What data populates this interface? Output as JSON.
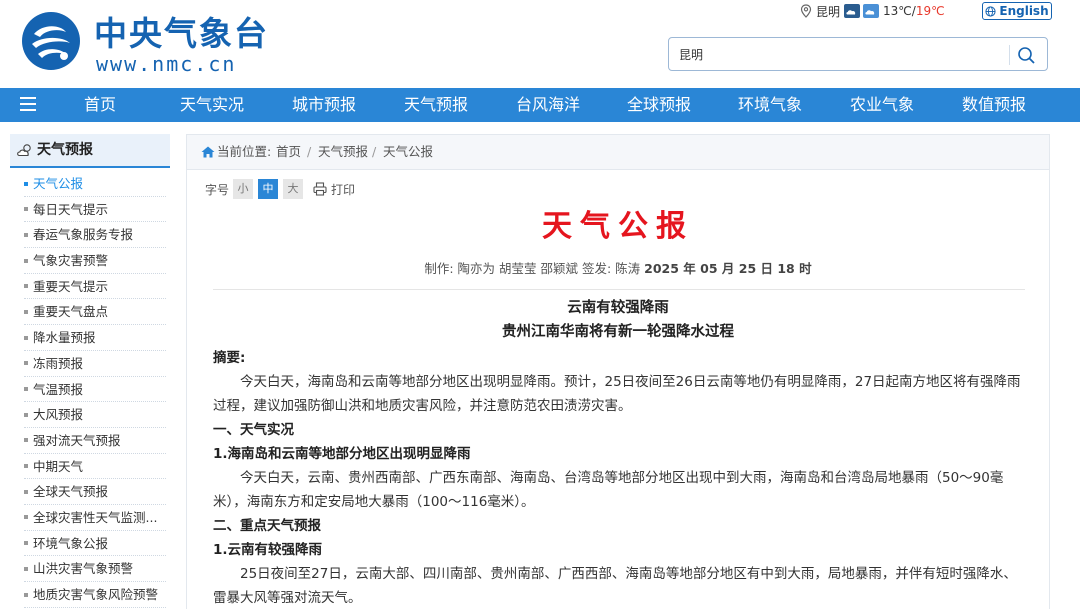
{
  "header": {
    "site_name_cn": "中央气象台",
    "site_name_en": "www.nmc.cn",
    "city": "昆明",
    "temp_low": "13℃",
    "temp_sep": "/",
    "temp_high": "19℃",
    "lang_label": "English",
    "search_value": "昆明"
  },
  "nav": {
    "items": [
      "首页",
      "天气实况",
      "城市预报",
      "天气预报",
      "台风海洋",
      "全球预报",
      "环境气象",
      "农业气象",
      "数值预报"
    ]
  },
  "sidebar": {
    "title": "天气预报",
    "items": [
      "天气公报",
      "每日天气提示",
      "春运气象服务专报",
      "气象灾害预警",
      "重要天气提示",
      "重要天气盘点",
      "降水量预报",
      "冻雨预报",
      "气温预报",
      "大风预报",
      "强对流天气预报",
      "中期天气",
      "全球天气预报",
      "全球灾害性天气监测...",
      "环境气象公报",
      "山洪灾害气象预警",
      "地质灾害气象风险预警"
    ]
  },
  "breadcrumb": {
    "prefix": "当前位置:",
    "items": [
      "首页",
      "天气预报",
      "天气公报"
    ]
  },
  "font_ctrl": {
    "label": "字号",
    "small": "小",
    "medium": "中",
    "large": "大",
    "print": "打印"
  },
  "article": {
    "title": "天气公报",
    "byline": "制作: 陶亦为 胡莹莹 邵颖斌 签发: 陈涛",
    "byline_date": "2025 年 05 月 25 日 18 时",
    "headline1": "云南有较强降雨",
    "headline2": "贵州江南华南将有新一轮强降水过程",
    "summary_label": "摘要:",
    "summary_text": "今天白天，海南岛和云南等地部分地区出现明显降雨。预计，25日夜间至26日云南等地仍有明显降雨，27日起南方地区将有强降雨过程，建议加强防御山洪和地质灾害风险，并注意防范农田渍涝灾害。",
    "sec1_title": "一、天气实况",
    "sec1_sub": "1.海南岛和云南等地部分地区出现明显降雨",
    "sec1_text": "今天白天，云南、贵州西南部、广西东南部、海南岛、台湾岛等地部分地区出现中到大雨，海南岛和台湾岛局地暴雨（50～90毫米），海南东方和定安局地大暴雨（100～116毫米）。",
    "sec2_title": "二、重点天气预报",
    "sec2_sub": "1.云南有较强降雨",
    "sec2_text": "25日夜间至27日，云南大部、四川南部、贵州南部、广西西部、海南岛等地部分地区有中到大雨，局地暴雨，并伴有短时强降水、雷暴大风等强对流天气。"
  },
  "colors": {
    "brand_blue": "#1563b1",
    "nav_blue": "#2a86d6",
    "title_red": "#e5151e",
    "active_link": "#1e8ee6"
  }
}
